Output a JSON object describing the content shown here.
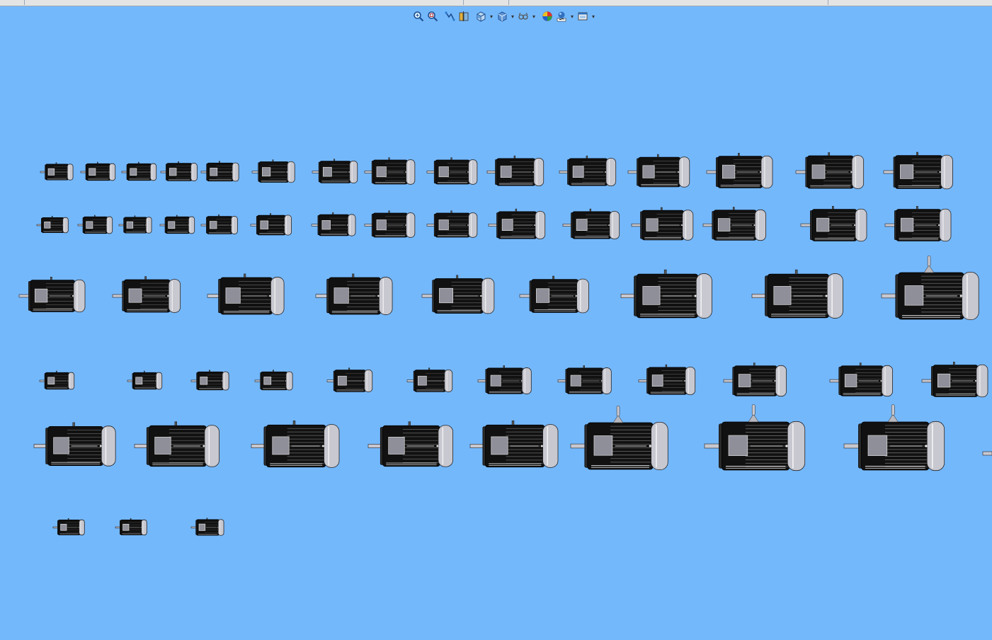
{
  "app": {
    "kind": "3D CAD assembly graphics area",
    "background_color": "#74b8fc",
    "model_color": "#111111",
    "endcap_color": "#c8c8d0"
  },
  "toolbar": {
    "items": [
      {
        "name": "zoom-to-fit-icon",
        "dropdown": false
      },
      {
        "name": "zoom-to-area-icon",
        "dropdown": false
      },
      {
        "name": "previous-view-icon",
        "dropdown": false
      },
      {
        "name": "section-view-icon",
        "dropdown": false
      },
      {
        "name": "view-orientation-icon",
        "dropdown": true
      },
      {
        "name": "display-style-icon",
        "dropdown": true
      },
      {
        "name": "hide-show-items-icon",
        "dropdown": true
      },
      {
        "name": "edit-appearance-icon",
        "dropdown": false
      },
      {
        "name": "apply-scene-icon",
        "dropdown": true
      },
      {
        "name": "view-settings-icon",
        "dropdown": true
      }
    ]
  },
  "motor_rows": [
    {
      "count": 15,
      "scales": [
        0.52,
        0.55,
        0.55,
        0.58,
        0.6,
        0.68,
        0.72,
        0.8,
        0.8,
        0.9,
        0.9,
        0.98,
        1.05,
        1.08,
        1.1
      ]
    },
    {
      "count": 15,
      "scales": [
        0.5,
        0.55,
        0.52,
        0.55,
        0.58,
        0.65,
        0.7,
        0.8,
        0.8,
        0.9,
        0.9,
        0.98,
        1.0,
        1.05,
        1.05
      ]
    },
    {
      "count": 9,
      "scales": [
        1.05,
        1.08,
        1.22,
        1.22,
        1.15,
        1.1,
        1.45,
        1.45,
        1.55
      ]
    },
    {
      "count": 12,
      "scales": [
        0.55,
        0.55,
        0.6,
        0.6,
        0.72,
        0.72,
        0.85,
        0.85,
        0.9,
        1.0,
        1.0,
        1.05
      ]
    },
    {
      "count": 8,
      "scales": [
        1.3,
        1.35,
        1.4,
        1.35,
        1.4,
        1.55,
        1.6,
        1.6
      ]
    },
    {
      "count": 3,
      "scales": [
        0.5,
        0.5,
        0.52
      ]
    }
  ]
}
